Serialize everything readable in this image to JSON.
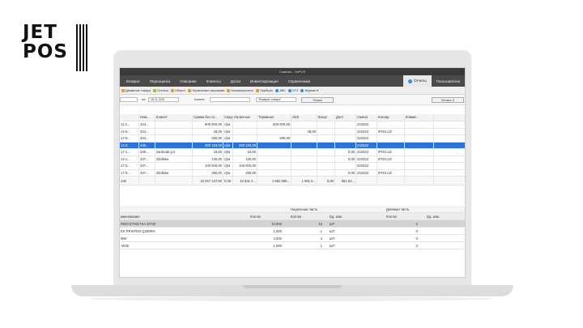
{
  "logo": {
    "line1": "JET",
    "line2": "POS"
  },
  "window": {
    "title": "Главная - JetPOS"
  },
  "menu": {
    "items": [
      "Возврат",
      "Переоценка",
      "Списание",
      "Клиенты",
      "Долги",
      "Инвентаризация",
      "Справочники"
    ],
    "active_tab": "Отчеты",
    "user_tab": "Пользователи"
  },
  "toolbar": {
    "items": [
      "Движение товара",
      "Остатки",
      "Оборот",
      "Управление закупками",
      "Взаиморасчеты",
      "Прибыль",
      "ABC",
      "XYZ",
      "Журнал"
    ]
  },
  "filter": {
    "to_label": "по:",
    "date_value": "18.11.2021",
    "client_label": "Клиент:",
    "type_value": "\"Возврат товара\"",
    "search_button": "Поиск",
    "print_button": "Печать Z"
  },
  "table": {
    "columns": [
      "",
      "Ном...",
      "Клиент",
      "Сумма без ск...",
      "Скидка",
      "Наличные",
      "Терминал",
      "click",
      "Бонус",
      "Долг",
      "Смена",
      "Кассир",
      "Комме..."
    ],
    "rows": [
      [
        "11:2...",
        "434...",
        "",
        "600 000,00",
        "сўм",
        "",
        "600 000,00",
        "",
        "",
        "",
        "243322",
        "",
        ""
      ],
      [
        "14:0...",
        "434...",
        "",
        "28,00",
        "сўм",
        "",
        "",
        "28,00",
        "",
        "",
        "243322",
        "IPOS.UZ",
        ""
      ],
      [
        "17:5...",
        "434...",
        "",
        "280,00",
        "сўм",
        "",
        "280,00",
        "",
        "",
        "",
        "243322",
        "",
        ""
      ],
      [
        "14:3...",
        "435...",
        "",
        "280 193,00",
        "сўм",
        "280 193,00",
        "",
        "",
        "",
        "",
        "243322",
        "",
        ""
      ],
      [
        "17:1...",
        "436...",
        "sardorak g-2",
        "15,00",
        "сўм",
        "15,00",
        "",
        "",
        "",
        "0,00",
        "243322",
        "IPOS.UZ",
        ""
      ],
      [
        "14:1...",
        "437...",
        "Zilolleka",
        "130,00",
        "сўм",
        "130,00",
        "",
        "",
        "",
        "0,00",
        "243322",
        "IPOS.UZ",
        ""
      ],
      [
        "17:0...",
        "437...",
        "",
        "100 000,00",
        "сўм",
        "100 000,00",
        "",
        "",
        "",
        "",
        "243322",
        "",
        ""
      ],
      [
        "17:0...",
        "437...",
        "Zilolleka",
        "290,00",
        "сўм",
        "290,00",
        "",
        "",
        "",
        "0,00",
        "243322",
        "IPOS.UZ",
        ""
      ]
    ],
    "selected_index": 3,
    "footer": [
      "120",
      "",
      "",
      "15 047 147,50",
      "0,00",
      "10 931 4...",
      "1 862 665...",
      "1 691 5...",
      "0,00",
      "561 53...",
      "",
      "",
      ""
    ]
  },
  "detail": {
    "group_week": "Недельная часть",
    "group_day": "Дневная часть",
    "columns": [
      "именование",
      "Кол-во",
      "Кол-во",
      "Ед. изм.",
      "Кол-во",
      "Ед. изм."
    ],
    "rows": [
      [
        "RMO ETIKETKA 40*30",
        "10,000",
        "10",
        "ШТ",
        "0",
        ""
      ],
      [
        "EK PRINTER Q260RH",
        "1,000",
        "1",
        "ШТ",
        "0",
        ""
      ],
      [
        "MM",
        "4,000",
        "4",
        "ШТ",
        "0",
        ""
      ],
      [
        "-W35",
        "1,000",
        "1",
        "ШТ",
        "0",
        ""
      ]
    ],
    "selected_index": 0
  }
}
